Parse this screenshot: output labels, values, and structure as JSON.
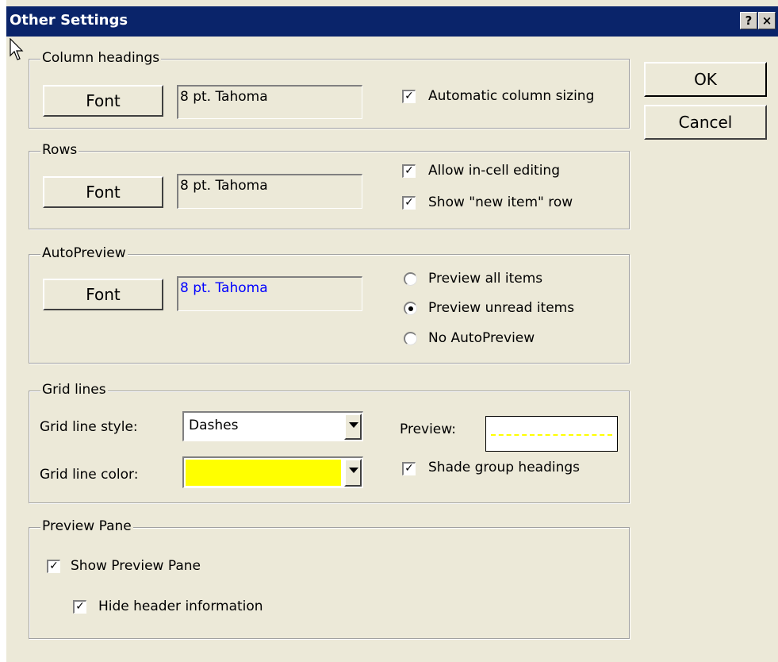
{
  "dialog": {
    "title": "Other Settings",
    "help_label": "?",
    "close_label": "×"
  },
  "buttons": {
    "ok": "OK",
    "cancel": "Cancel"
  },
  "column_headings": {
    "legend": "Column headings",
    "font_button": "Font",
    "font_value": "8 pt. Tahoma",
    "auto_sizing_label": "Automatic column sizing",
    "auto_sizing_checked": true
  },
  "rows": {
    "legend": "Rows",
    "font_button": "Font",
    "font_value": "8 pt. Tahoma",
    "in_cell_label": "Allow in-cell editing",
    "in_cell_checked": true,
    "new_item_label": "Show \"new item\" row",
    "new_item_checked": true
  },
  "autopreview": {
    "legend": "AutoPreview",
    "font_button": "Font",
    "font_value": "8 pt. Tahoma",
    "font_value_color": "#0000ff",
    "options": [
      "Preview all items",
      "Preview unread items",
      "No AutoPreview"
    ],
    "selected": "Preview unread items"
  },
  "grid_lines": {
    "legend": "Grid lines",
    "style_label": "Grid line style:",
    "style_value": "Dashes",
    "color_label": "Grid line color:",
    "color_value": "#ffff00",
    "preview_label": "Preview:",
    "shade_label": "Shade group headings",
    "shade_checked": true
  },
  "preview_pane": {
    "legend": "Preview Pane",
    "show_label": "Show Preview Pane",
    "show_checked": true,
    "hide_header_label": "Hide header information",
    "hide_header_checked": true
  },
  "colors": {
    "title_bar": "#0a246a",
    "dialog_bg": "#ece9d8"
  }
}
